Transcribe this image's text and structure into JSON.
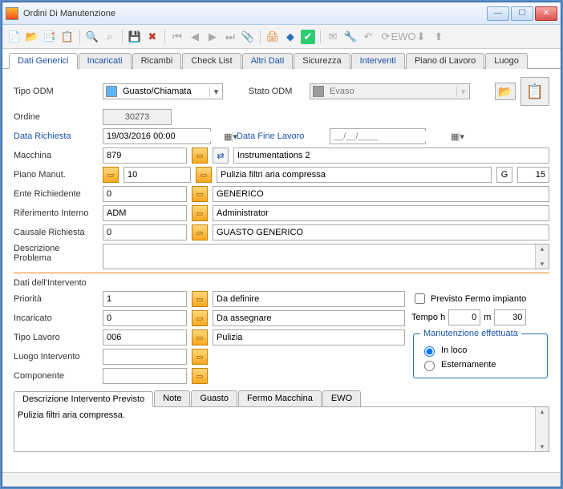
{
  "window": {
    "title": "Ordini Di Manutenzione"
  },
  "tabs": [
    {
      "label": "Dati Generici",
      "link": true,
      "active": true
    },
    {
      "label": "Incaricati",
      "link": true
    },
    {
      "label": "Ricambi"
    },
    {
      "label": "Check List"
    },
    {
      "label": "Altri Dati",
      "link": true
    },
    {
      "label": "Sicurezza"
    },
    {
      "label": "Interventi",
      "link": true
    },
    {
      "label": "Piano di Lavoro"
    },
    {
      "label": "Luogo"
    }
  ],
  "header": {
    "tipo_odm_label": "Tipo ODM",
    "tipo_odm_value": "Guasto/Chiamata",
    "tipo_odm_color": "#5fb4ff",
    "stato_odm_label": "Stato ODM",
    "stato_odm_value": "Evaso",
    "stato_odm_color": "#9a9a9a",
    "ordine_label": "Ordine",
    "ordine_value": "30273",
    "data_richiesta_label": "Data Richiesta",
    "data_richiesta_value": "19/03/2016 00:00",
    "data_fine_lavoro_label": "Data Fine Lavoro",
    "data_fine_lavoro_value": "__/__/____"
  },
  "fields": {
    "macchina_label": "Macchina",
    "macchina_code": "879",
    "macchina_desc": "Instrumentations 2",
    "piano_manut_label": "Piano Manut.",
    "piano_manut_code": "10",
    "piano_manut_desc": "Pulizia filtri aria compressa",
    "g_label": "G",
    "g_value": "15",
    "ente_rich_label": "Ente Richiedente",
    "ente_rich_code": "0",
    "ente_rich_desc": "GENERICO",
    "rif_interno_label": "Riferimento Interno",
    "rif_interno_code": "ADM",
    "rif_interno_desc": "Administrator",
    "causale_label": "Causale Richiesta",
    "causale_code": "0",
    "causale_desc": "GUASTO GENERICO",
    "desc_problema_label": "Descrizione Problema",
    "desc_problema_value": ""
  },
  "intervento": {
    "section_label": "Dati dell'Intervento",
    "priorita_label": "Priorità",
    "priorita_code": "1",
    "priorita_desc": "Da definire",
    "incaricato_label": "Incaricato",
    "incaricato_code": "0",
    "incaricato_desc": "Da assegnare",
    "tipo_lavoro_label": "Tipo Lavoro",
    "tipo_lavoro_code": "006",
    "tipo_lavoro_desc": "Pulizia",
    "luogo_label": "Luogo Intervento",
    "luogo_code": "",
    "componente_label": "Componente",
    "componente_code": "",
    "previsto_fermo_label": "Previsto Fermo impianto",
    "tempo_label": "Tempo  h",
    "tempo_h": "0",
    "tempo_m_label": "m",
    "tempo_m": "30",
    "manut_eff_label": "Manutenzione effettuata",
    "radio_inloco": "In loco",
    "radio_est": "Esternamente"
  },
  "subtabs": [
    {
      "label": "Descrizione Intervento Previsto",
      "active": true
    },
    {
      "label": "Note"
    },
    {
      "label": "Guasto"
    },
    {
      "label": "Fermo Macchina"
    },
    {
      "label": "EWO"
    }
  ],
  "desc_intervento": "Pulizia filtri aria compressa."
}
